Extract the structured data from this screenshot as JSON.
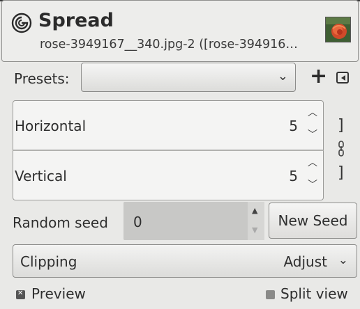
{
  "header": {
    "title": "Spread",
    "subtitle": "rose-3949167__340.jpg-2 ([rose-394916…",
    "icon": "spread-icon",
    "thumbnail": "rose-thumbnail"
  },
  "presets": {
    "label": "Presets:",
    "selected": "",
    "add_icon": "plus-icon",
    "menu_icon": "triangle-left-icon"
  },
  "spread": {
    "horizontal": {
      "label": "Horizontal",
      "value": "5"
    },
    "vertical": {
      "label": "Vertical",
      "value": "5"
    },
    "chain_icon": "chain-link-icon"
  },
  "seed": {
    "label": "Random seed",
    "value": "0",
    "new_seed_label": "New Seed"
  },
  "clipping": {
    "label": "Clipping",
    "value": "Adjust"
  },
  "footer": {
    "preview_label": "Preview",
    "preview_checked": true,
    "split_view_label": "Split view",
    "split_view_checked": false
  },
  "colors": {
    "background": "#e9e9e7",
    "field": "#f4f4f3",
    "seed_field": "#c8c8c6"
  }
}
